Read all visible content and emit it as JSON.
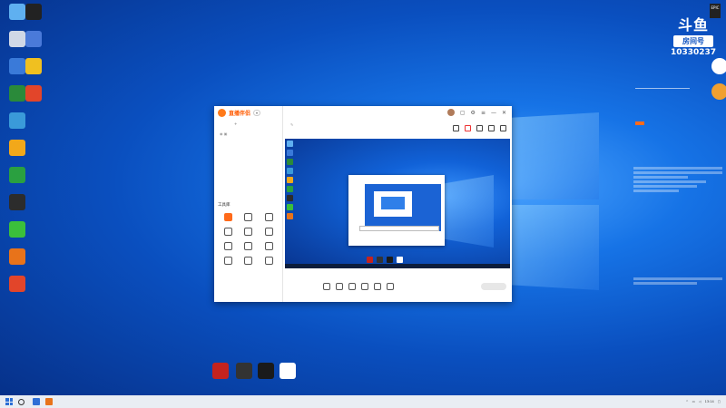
{
  "desktop_icons_left": [
    {
      "label": "",
      "color": "#5fb0f0"
    },
    {
      "label": "",
      "color": "#d0d8e6"
    },
    {
      "label": "",
      "color": "#3a7ad9"
    },
    {
      "label": "",
      "color": "#2a8a3a"
    },
    {
      "label": "",
      "color": "#3a9ad9"
    },
    {
      "label": "",
      "color": "#f2a81a"
    },
    {
      "label": "",
      "color": "#2aa040"
    },
    {
      "label": "",
      "color": "#2c2c2c"
    },
    {
      "label": "",
      "color": "#3bbf3b"
    },
    {
      "label": "",
      "color": "#e8731a"
    },
    {
      "label": "",
      "color": "#e2452a"
    }
  ],
  "desktop_icons_col2": [
    {
      "label": "",
      "color": "#222222"
    },
    {
      "label": "",
      "color": "#4a7ad9"
    },
    {
      "label": "",
      "color": "#f0c020"
    },
    {
      "label": "",
      "color": "#e2452a"
    }
  ],
  "desktop_icons_bottom": [
    {
      "label": "",
      "color": "#c4231e"
    },
    {
      "label": "",
      "color": "#333333"
    },
    {
      "label": "",
      "color": "#1a1a1a"
    },
    {
      "label": "",
      "color": "#ffffff"
    }
  ],
  "brand": {
    "line1": "斗鱼",
    "line2": "房间号",
    "room_number": "10330237"
  },
  "app": {
    "name": "直播伴侣",
    "tabs": [
      "",
      "",
      ""
    ],
    "tools_title": "工具库",
    "tools": [
      "",
      "",
      "",
      "",
      "",
      "",
      "",
      "",
      "",
      "",
      "",
      ""
    ],
    "footer": [
      "",
      "",
      "",
      ""
    ],
    "bottom_actions": [
      "",
      "",
      "",
      "",
      "",
      ""
    ],
    "start_label": "",
    "tooltip": ""
  },
  "taskbar": {
    "time": "13:14",
    "date": ""
  },
  "colors": {
    "accent": "#ff5a00",
    "desktop": "#1673e6"
  }
}
